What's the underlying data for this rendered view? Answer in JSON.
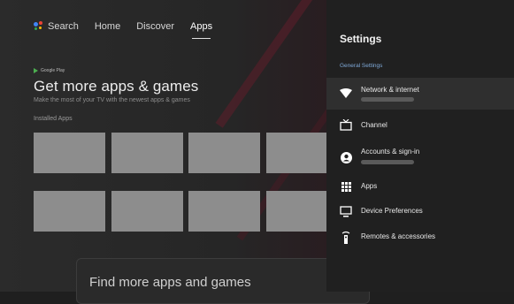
{
  "nav": {
    "search_label": "Search",
    "items": [
      "Home",
      "Discover",
      "Apps"
    ]
  },
  "hero": {
    "google_play": "Google Play",
    "title": "Get more apps & games",
    "subtitle": "Make the most of your TV with the newest apps & games",
    "installed_label": "Installed Apps"
  },
  "find": {
    "label": "Find more apps and games"
  },
  "settings": {
    "title": "Settings",
    "section": "General Settings",
    "items": [
      {
        "label": "Network & internet",
        "icon": "wifi-icon"
      },
      {
        "label": "Channel",
        "icon": "tv-channel-icon"
      },
      {
        "label": "Accounts & sign-in",
        "icon": "account-icon"
      },
      {
        "label": "Apps",
        "icon": "apps-grid-icon"
      },
      {
        "label": "Device Preferences",
        "icon": "display-icon"
      },
      {
        "label": "Remotes & accessories",
        "icon": "remote-icon"
      }
    ]
  },
  "colors": {
    "accent": "#7fa9d8",
    "tile": "#8d8d8d",
    "panel": "#202020"
  }
}
